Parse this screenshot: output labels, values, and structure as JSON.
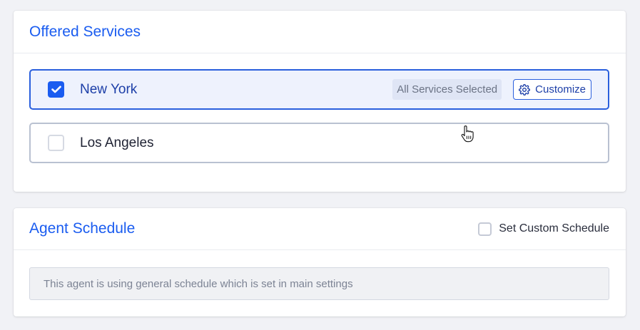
{
  "services_card": {
    "title": "Offered Services",
    "locations": [
      {
        "name": "New York",
        "checked": true,
        "badge": "All Services Selected",
        "customize_label": "Customize"
      },
      {
        "name": "Los Angeles",
        "checked": false
      }
    ]
  },
  "schedule_card": {
    "title": "Agent Schedule",
    "custom_schedule_label": "Set Custom Schedule",
    "custom_schedule_checked": false,
    "note": "This agent is using general schedule which is set in main settings"
  },
  "colors": {
    "accent": "#1a5cf0",
    "selected_row_bg": "#eef2fd",
    "page_bg": "#f1f2f6"
  },
  "icons": {
    "checked_box": "checkmark-icon",
    "customize": "gear-icon",
    "cursor": "hand-pointer-icon"
  }
}
